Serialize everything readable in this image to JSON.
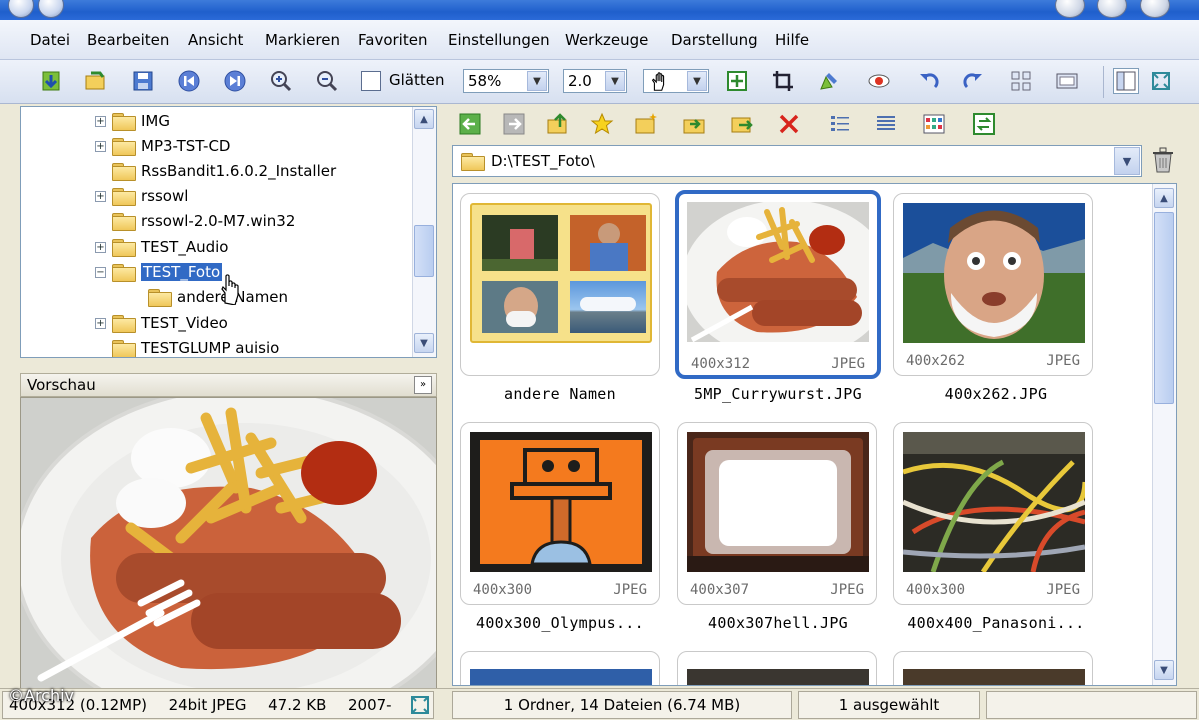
{
  "menu": {
    "items": [
      "Datei",
      "Bearbeiten",
      "Ansicht",
      "Markieren",
      "Favoriten",
      "Einstellungen",
      "Werkzeuge",
      "Darstellung",
      "Hilfe"
    ]
  },
  "toolbar": {
    "smooth_label": "Glätten",
    "zoom_value": "58%",
    "factor_value": "2.0"
  },
  "tree": {
    "items": [
      {
        "label": "IMG",
        "expander": "+"
      },
      {
        "label": "MP3-TST-CD",
        "expander": "+"
      },
      {
        "label": "RssBandit1.6.0.2_Installer",
        "expander": ""
      },
      {
        "label": "rssowl",
        "expander": "+"
      },
      {
        "label": "rssowl-2.0-M7.win32",
        "expander": ""
      },
      {
        "label": "TEST_Audio",
        "expander": "+"
      },
      {
        "label": "TEST_Foto",
        "expander": "−",
        "selected": true
      },
      {
        "label": "andere Namen",
        "expander": "",
        "child": true
      },
      {
        "label": "TEST_Video",
        "expander": "+"
      },
      {
        "label": "TESTGLUMP auisio",
        "expander": ""
      }
    ]
  },
  "preview": {
    "title": "Vorschau"
  },
  "address": {
    "path": "D:\\TEST_Foto\\"
  },
  "thumbnails": [
    {
      "caption": "andere Namen",
      "dims": "",
      "format": "",
      "kind": "folder"
    },
    {
      "caption": "5MP_Currywurst.JPG",
      "dims": "400x312",
      "format": "JPEG",
      "kind": "currywurst",
      "selected": true
    },
    {
      "caption": "400x262.JPG",
      "dims": "400x262",
      "format": "JPEG",
      "kind": "face"
    },
    {
      "caption": "400x300_Olympus...",
      "dims": "400x300",
      "format": "JPEG",
      "kind": "orange"
    },
    {
      "caption": "400x307hell.JPG",
      "dims": "400x307",
      "format": "JPEG",
      "kind": "tv"
    },
    {
      "caption": "400x400_Panasoni...",
      "dims": "400x300",
      "format": "JPEG",
      "kind": "cables"
    }
  ],
  "status": {
    "image_info": "400x312 (0.12MP)",
    "bit_info": "24bit JPEG",
    "size": "47.2 KB",
    "date": "2007-",
    "folder_info": "1 Ordner, 14 Dateien (6.74 MB)",
    "selection": "1 ausgewählt"
  },
  "watermark": "©Archiv"
}
